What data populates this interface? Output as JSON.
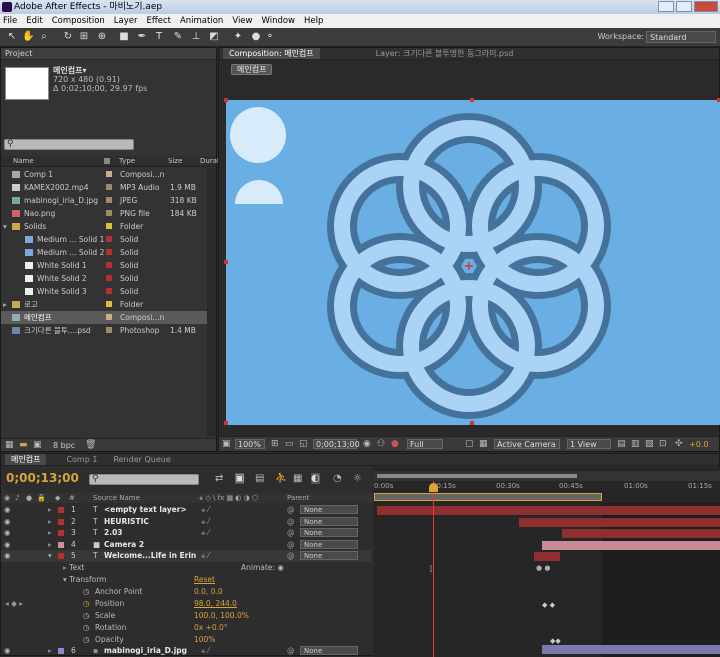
{
  "window": {
    "title": "Adobe After Effects - 마비노기.aep"
  },
  "menu": [
    "File",
    "Edit",
    "Composition",
    "Layer",
    "Effect",
    "Animation",
    "View",
    "Window",
    "Help"
  ],
  "toolbar": {
    "workspace_label": "Workspace:",
    "workspace_value": "Standard"
  },
  "project": {
    "tab": "Project",
    "selected_name": "메인컴프▾",
    "info_size": "720 x 480 (0.91)",
    "info_duration": "Δ 0;02;10;00, 29.97 fps",
    "columns": {
      "name": "Name",
      "type": "Type",
      "size": "Size",
      "duration": "Durat"
    },
    "items": [
      {
        "name": "Comp 1",
        "type": "Composi...n",
        "size": "",
        "icon": "comp-icon",
        "label": "#c9b08a"
      },
      {
        "name": "KAMEX2002.mp4",
        "type": "MP3 Audio",
        "size": "1.9 MB",
        "icon": "audio-icon",
        "label": "#a08a6a"
      },
      {
        "name": "mabinogi_iria_D.jpg",
        "type": "JPEG",
        "size": "318 KB",
        "icon": "image-icon",
        "label": "#a08a6a"
      },
      {
        "name": "Nao.png",
        "type": "PNG file",
        "size": "184 KB",
        "icon": "image-icon",
        "label": "#a08a6a"
      },
      {
        "name": "Solids",
        "type": "Folder",
        "size": "",
        "icon": "folder-icon",
        "label": "#d8c23a"
      },
      {
        "name": "Medium ... Solid 1",
        "type": "Solid",
        "size": "",
        "icon": "solid-icon",
        "label": "#b33030"
      },
      {
        "name": "Medium ... Solid 2",
        "type": "Solid",
        "size": "",
        "icon": "solid-icon",
        "label": "#b33030"
      },
      {
        "name": "White Solid 1",
        "type": "Solid",
        "size": "",
        "icon": "solid-icon",
        "label": "#b33030"
      },
      {
        "name": "White Solid 2",
        "type": "Solid",
        "size": "",
        "icon": "solid-icon",
        "label": "#b33030"
      },
      {
        "name": "White Solid 3",
        "type": "Solid",
        "size": "",
        "icon": "solid-icon",
        "label": "#b33030"
      },
      {
        "name": "로고",
        "type": "Folder",
        "size": "",
        "icon": "folder-icon",
        "label": "#d8c23a"
      },
      {
        "name": "메인컴프",
        "type": "Composi...n",
        "size": "",
        "icon": "comp-icon",
        "label": "#c9b08a"
      },
      {
        "name": "크기다른 블투....psd",
        "type": "Photoshop",
        "size": "1.4 MB",
        "icon": "image-icon",
        "label": "#a08a6a"
      }
    ],
    "bpc": "8 bpc"
  },
  "composition": {
    "tab_comp": "Composition: 메인컴프",
    "tab_layer": "Layer: 크기다른 블투명한 동그라미.psd",
    "comp_button": "메인컴프",
    "zoom": "100%",
    "timecode": "0;00;13;00",
    "resolution": "Full",
    "camera": "Active Camera",
    "views": "1 View",
    "exposure": "+0.0",
    "bg_color": "#6aafe4"
  },
  "timeline": {
    "tabs": [
      "메인컴프",
      "Comp 1",
      "Render Queue"
    ],
    "current_time": "0;00;13;00",
    "columns": {
      "source_name": "Source Name",
      "parent": "Parent"
    },
    "ruler": [
      "0:00s",
      "00:15s",
      "00:30s",
      "00:45s",
      "01:00s",
      "01:15s"
    ],
    "layers": [
      {
        "num": "1",
        "name": "<empty text layer>",
        "label": "#b33030",
        "parent": "None"
      },
      {
        "num": "2",
        "name": "HEURISTIC",
        "label": "#b33030",
        "parent": "None"
      },
      {
        "num": "3",
        "name": "2.03",
        "label": "#b33030",
        "parent": "None"
      },
      {
        "num": "4",
        "name": "Camera 2",
        "label": "#d88c9a",
        "parent": "None"
      },
      {
        "num": "5",
        "name": "Welcome...Life in Erin",
        "label": "#b33030",
        "parent": "None"
      },
      {
        "num": "6",
        "name": "mabinogi_iria_D.jpg",
        "label": "#8a8ac9",
        "parent": "None"
      }
    ],
    "props": {
      "text": "Text",
      "animate": "Animate:",
      "transform": "Transform",
      "reset": "Reset",
      "anchor": "Anchor Point",
      "anchor_val": "0.0, 0.0",
      "position": "Position",
      "position_val": "98.0, 244.0",
      "scale": "Scale",
      "scale_val": "100.0, 100.0%",
      "rotation": "Rotation",
      "rotation_val": "0x +0.0°",
      "opacity": "Opacity",
      "opacity_val": "100%"
    }
  }
}
